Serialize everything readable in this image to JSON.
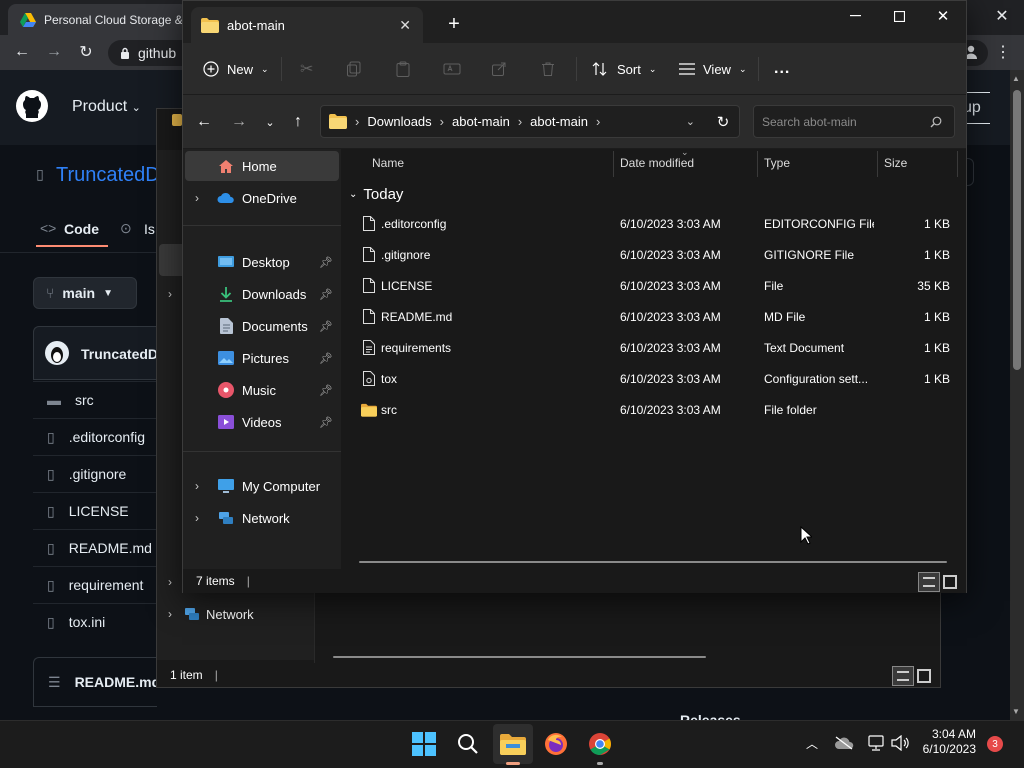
{
  "browser": {
    "tab_title": "Personal Cloud Storage &",
    "url": "github",
    "gh_nav_product": "Product",
    "gh_signup_partial": "up",
    "repo_name": "TruncatedD",
    "tab_code": "Code",
    "tab_issues": "Is",
    "branch": "main",
    "commit_author": "TruncatedDi",
    "files": [
      "src",
      ".editorconfig",
      ".gitignore",
      "LICENSE",
      "README.md",
      "requirement",
      "tox.ini"
    ],
    "readme_header": "README.md",
    "releases": "Releases"
  },
  "explorer_back": {
    "nav_network": "Network",
    "status_count": "1 item"
  },
  "explorer": {
    "tab_title": "abot-main",
    "toolbar": {
      "new_label": "New",
      "sort_label": "Sort",
      "view_label": "View",
      "more_label": "..."
    },
    "breadcrumb": [
      "Downloads",
      "abot-main",
      "abot-main"
    ],
    "search_placeholder": "Search abot-main",
    "nav": {
      "home": "Home",
      "onedrive": "OneDrive",
      "desktop": "Desktop",
      "downloads": "Downloads",
      "documents": "Documents",
      "pictures": "Pictures",
      "music": "Music",
      "videos": "Videos",
      "my_computer": "My Computer",
      "network": "Network"
    },
    "columns": {
      "name": "Name",
      "date": "Date modified",
      "type": "Type",
      "size": "Size"
    },
    "group_label": "Today",
    "files": [
      {
        "name": ".editorconfig",
        "date": "6/10/2023 3:03 AM",
        "type": "EDITORCONFIG File",
        "size": "1 KB",
        "icon": "file-icon"
      },
      {
        "name": ".gitignore",
        "date": "6/10/2023 3:03 AM",
        "type": "GITIGNORE File",
        "size": "1 KB",
        "icon": "file-icon"
      },
      {
        "name": "LICENSE",
        "date": "6/10/2023 3:03 AM",
        "type": "File",
        "size": "35 KB",
        "icon": "file-icon"
      },
      {
        "name": "README.md",
        "date": "6/10/2023 3:03 AM",
        "type": "MD File",
        "size": "1 KB",
        "icon": "file-icon"
      },
      {
        "name": "requirements",
        "date": "6/10/2023 3:03 AM",
        "type": "Text Document",
        "size": "1 KB",
        "icon": "text-file-icon"
      },
      {
        "name": "tox",
        "date": "6/10/2023 3:03 AM",
        "type": "Configuration sett...",
        "size": "1 KB",
        "icon": "settings-file-icon"
      },
      {
        "name": "src",
        "date": "6/10/2023 3:03 AM",
        "type": "File folder",
        "size": "",
        "icon": "folder-icon"
      }
    ],
    "status_count": "7 items"
  },
  "taskbar": {
    "time": "3:04 AM",
    "date": "6/10/2023",
    "notification_count": "3"
  }
}
